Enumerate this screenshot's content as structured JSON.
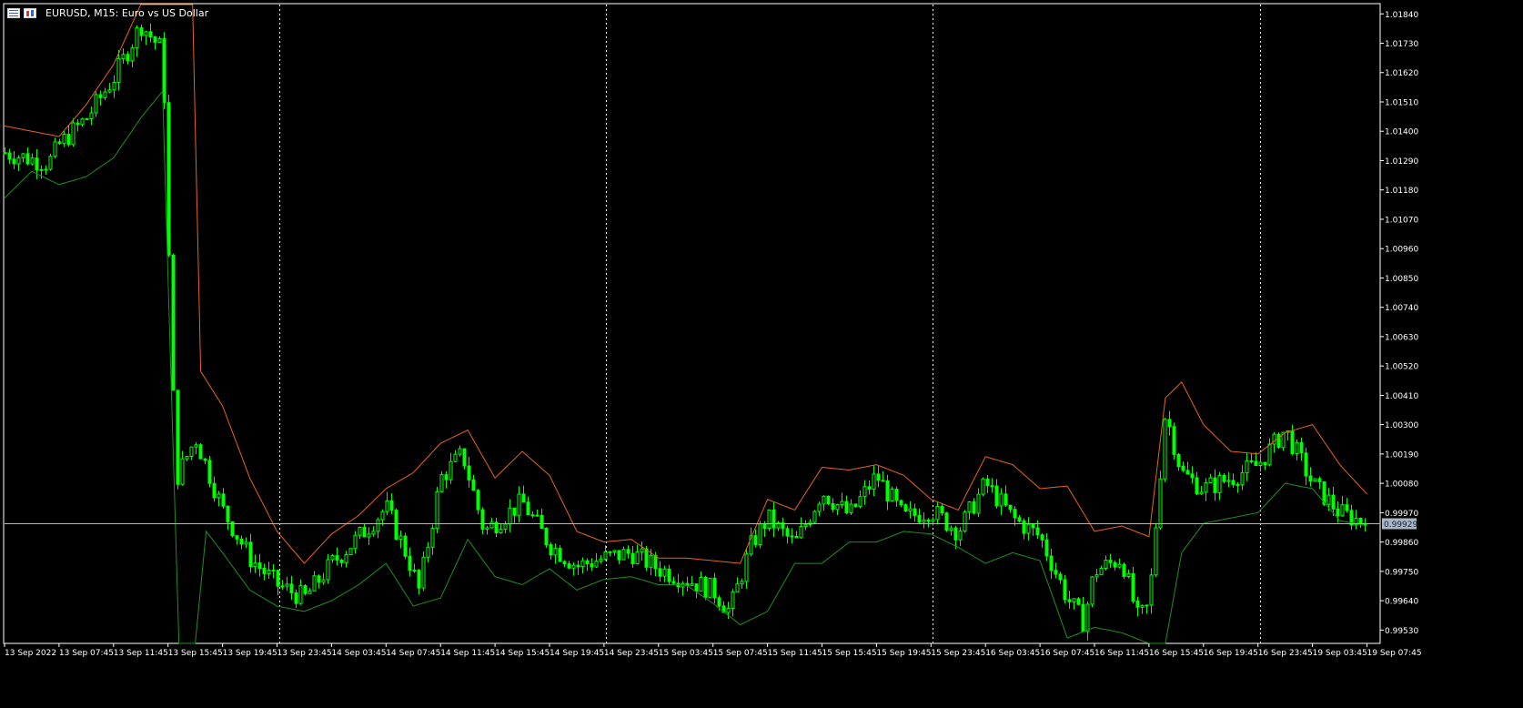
{
  "window": {
    "symbol_title": "EURUSD, M15:  Euro vs US Dollar"
  },
  "colors": {
    "background": "#000000",
    "frame": "#ffffff",
    "candles": "#00ff00",
    "upper_band": "#e8641a",
    "lower_band": "#1f8f1f",
    "bid_line": "#aab8c8",
    "price_tag_bg": "#a9b6c7",
    "price_tag_text": "#1a2330",
    "axis_text": "#ffffff",
    "period_separators": "#ffffff"
  },
  "price_axis": {
    "labels": [
      "1.01840",
      "1.01730",
      "1.01620",
      "1.01510",
      "1.01400",
      "1.01290",
      "1.01180",
      "1.01070",
      "1.00960",
      "1.00850",
      "1.00740",
      "1.00630",
      "1.00520",
      "1.00410",
      "1.00300",
      "1.00190",
      "1.00080",
      "0.99970",
      "0.99860",
      "0.99750",
      "0.99640",
      "0.99530"
    ],
    "range": [
      0.9948,
      1.01875
    ],
    "current_price": "0.99929",
    "current_price_value": 0.99929
  },
  "time_axis": {
    "labels": [
      "13 Sep 2022",
      "13 Sep 07:45",
      "13 Sep 11:45",
      "13 Sep 15:45",
      "13 Sep 19:45",
      "13 Sep 23:45",
      "14 Sep 03:45",
      "14 Sep 07:45",
      "14 Sep 11:45",
      "14 Sep 15:45",
      "14 Sep 19:45",
      "14 Sep 23:45",
      "15 Sep 03:45",
      "15 Sep 07:45",
      "15 Sep 11:45",
      "15 Sep 15:45",
      "15 Sep 19:45",
      "15 Sep 23:45",
      "16 Sep 03:45",
      "16 Sep 07:45",
      "16 Sep 11:45",
      "16 Sep 15:45",
      "16 Sep 19:45",
      "16 Sep 23:45",
      "19 Sep 03:45",
      "19 Sep 07:45"
    ]
  },
  "chart_data": {
    "type": "candlestick",
    "symbol": "EURUSD",
    "timeframe": "M15",
    "indicator": "bands",
    "x": [
      "13 Sep 2022",
      "13 Sep 07:45",
      "13 Sep 11:45",
      "13 Sep 15:45",
      "13 Sep 19:45",
      "13 Sep 23:45",
      "14 Sep 03:45",
      "14 Sep 07:45",
      "14 Sep 11:45",
      "14 Sep 15:45",
      "14 Sep 19:45",
      "14 Sep 23:45",
      "15 Sep 03:45",
      "15 Sep 07:45",
      "15 Sep 11:45",
      "15 Sep 15:45",
      "15 Sep 19:45",
      "15 Sep 23:45",
      "16 Sep 03:45",
      "16 Sep 07:45",
      "16 Sep 11:45",
      "16 Sep 15:45",
      "16 Sep 19:45",
      "16 Sep 23:45",
      "19 Sep 03:45",
      "19 Sep 07:45"
    ],
    "close_anchors": [
      {
        "x": 0,
        "close": 1.0132
      },
      {
        "x": 0.8,
        "close": 1.0128
      },
      {
        "x": 1.0,
        "close": 1.0135
      },
      {
        "x": 1.5,
        "close": 1.0145
      },
      {
        "x": 2.0,
        "close": 1.016
      },
      {
        "x": 2.5,
        "close": 1.018
      },
      {
        "x": 2.9,
        "close": 1.017
      },
      {
        "x": 3.05,
        "close": 1.006
      },
      {
        "x": 3.15,
        "close": 1.001
      },
      {
        "x": 3.5,
        "close": 1.0025
      },
      {
        "x": 4.0,
        "close": 0.9998
      },
      {
        "x": 4.5,
        "close": 0.998
      },
      {
        "x": 5.0,
        "close": 0.997
      },
      {
        "x": 5.5,
        "close": 0.9965
      },
      {
        "x": 6.0,
        "close": 0.9978
      },
      {
        "x": 6.5,
        "close": 0.9988
      },
      {
        "x": 7.0,
        "close": 0.9999
      },
      {
        "x": 7.4,
        "close": 0.998
      },
      {
        "x": 7.6,
        "close": 0.9968
      },
      {
        "x": 8.0,
        "close": 1.001
      },
      {
        "x": 8.4,
        "close": 1.0019
      },
      {
        "x": 8.8,
        "close": 0.999
      },
      {
        "x": 9.5,
        "close": 1.0001
      },
      {
        "x": 10.0,
        "close": 0.9985
      },
      {
        "x": 10.5,
        "close": 0.9977
      },
      {
        "x": 11.0,
        "close": 0.998
      },
      {
        "x": 11.5,
        "close": 0.9982
      },
      {
        "x": 12.0,
        "close": 0.9976
      },
      {
        "x": 12.5,
        "close": 0.9972
      },
      {
        "x": 13.0,
        "close": 0.9968
      },
      {
        "x": 13.3,
        "close": 0.996
      },
      {
        "x": 13.7,
        "close": 0.9985
      },
      {
        "x": 14.0,
        "close": 0.9995
      },
      {
        "x": 14.5,
        "close": 0.9985
      },
      {
        "x": 15.0,
        "close": 1.0005
      },
      {
        "x": 15.5,
        "close": 0.9996
      },
      {
        "x": 16.0,
        "close": 1.0011
      },
      {
        "x": 16.5,
        "close": 0.9995
      },
      {
        "x": 17.0,
        "close": 0.9998
      },
      {
        "x": 17.5,
        "close": 0.999
      },
      {
        "x": 18.0,
        "close": 1.0008
      },
      {
        "x": 18.5,
        "close": 0.9995
      },
      {
        "x": 19.0,
        "close": 0.9988
      },
      {
        "x": 19.5,
        "close": 0.9965
      },
      {
        "x": 19.8,
        "close": 0.9956
      },
      {
        "x": 20.0,
        "close": 0.9975
      },
      {
        "x": 20.5,
        "close": 0.998
      },
      {
        "x": 20.8,
        "close": 0.9957
      },
      {
        "x": 21.0,
        "close": 0.9962
      },
      {
        "x": 21.3,
        "close": 1.0035
      },
      {
        "x": 21.6,
        "close": 1.0012
      },
      {
        "x": 22.0,
        "close": 1.0006
      },
      {
        "x": 22.5,
        "close": 1.001
      },
      {
        "x": 23.0,
        "close": 1.0015
      },
      {
        "x": 23.5,
        "close": 1.0028
      },
      {
        "x": 24.0,
        "close": 1.0008
      },
      {
        "x": 24.5,
        "close": 0.9997
      },
      {
        "x": 25.0,
        "close": 0.99929
      }
    ],
    "upper_band_anchors": [
      {
        "x": 0,
        "value": 1.0142
      },
      {
        "x": 1.0,
        "value": 1.0138
      },
      {
        "x": 1.5,
        "value": 1.015
      },
      {
        "x": 2.0,
        "value": 1.0165
      },
      {
        "x": 2.5,
        "value": 1.01875
      },
      {
        "x": 3.45,
        "value": 1.01875
      },
      {
        "x": 3.6,
        "value": 1.005
      },
      {
        "x": 4.0,
        "value": 1.0037
      },
      {
        "x": 4.5,
        "value": 1.001
      },
      {
        "x": 5.0,
        "value": 0.999
      },
      {
        "x": 5.5,
        "value": 0.9978
      },
      {
        "x": 6.0,
        "value": 0.9989
      },
      {
        "x": 6.5,
        "value": 0.9996
      },
      {
        "x": 7.0,
        "value": 1.0006
      },
      {
        "x": 7.5,
        "value": 1.0012
      },
      {
        "x": 8.0,
        "value": 1.0023
      },
      {
        "x": 8.5,
        "value": 1.0028
      },
      {
        "x": 9.0,
        "value": 1.001
      },
      {
        "x": 9.5,
        "value": 1.002
      },
      {
        "x": 10.0,
        "value": 1.0011
      },
      {
        "x": 10.5,
        "value": 0.999
      },
      {
        "x": 11.0,
        "value": 0.9986
      },
      {
        "x": 11.5,
        "value": 0.9987
      },
      {
        "x": 12.0,
        "value": 0.998
      },
      {
        "x": 12.5,
        "value": 0.998
      },
      {
        "x": 13.0,
        "value": 0.9979
      },
      {
        "x": 13.5,
        "value": 0.9978
      },
      {
        "x": 14.0,
        "value": 1.0002
      },
      {
        "x": 14.5,
        "value": 0.9998
      },
      {
        "x": 15.0,
        "value": 1.0014
      },
      {
        "x": 15.5,
        "value": 1.0013
      },
      {
        "x": 16.0,
        "value": 1.0015
      },
      {
        "x": 16.5,
        "value": 1.0011
      },
      {
        "x": 17.0,
        "value": 1.0002
      },
      {
        "x": 17.5,
        "value": 0.9998
      },
      {
        "x": 18.0,
        "value": 1.0018
      },
      {
        "x": 18.5,
        "value": 1.0015
      },
      {
        "x": 19.0,
        "value": 1.0006
      },
      {
        "x": 19.5,
        "value": 1.0007
      },
      {
        "x": 20.0,
        "value": 0.999
      },
      {
        "x": 20.5,
        "value": 0.9992
      },
      {
        "x": 21.0,
        "value": 0.9988
      },
      {
        "x": 21.3,
        "value": 1.004
      },
      {
        "x": 21.6,
        "value": 1.0046
      },
      {
        "x": 22.0,
        "value": 1.003
      },
      {
        "x": 22.5,
        "value": 1.002
      },
      {
        "x": 23.0,
        "value": 1.0019
      },
      {
        "x": 23.5,
        "value": 1.0027
      },
      {
        "x": 24.0,
        "value": 1.003
      },
      {
        "x": 24.5,
        "value": 1.0015
      },
      {
        "x": 25.0,
        "value": 1.0004
      }
    ],
    "lower_band_anchors": [
      {
        "x": 0,
        "value": 1.0115
      },
      {
        "x": 0.5,
        "value": 1.0125
      },
      {
        "x": 1.0,
        "value": 1.012
      },
      {
        "x": 1.5,
        "value": 1.0123
      },
      {
        "x": 2.0,
        "value": 1.013
      },
      {
        "x": 2.5,
        "value": 1.0145
      },
      {
        "x": 2.9,
        "value": 1.0155
      },
      {
        "x": 3.05,
        "value": 1.005
      },
      {
        "x": 3.2,
        "value": 0.9948
      },
      {
        "x": 3.5,
        "value": 0.9948
      },
      {
        "x": 3.7,
        "value": 0.999
      },
      {
        "x": 4.0,
        "value": 0.9982
      },
      {
        "x": 4.5,
        "value": 0.9968
      },
      {
        "x": 5.0,
        "value": 0.9962
      },
      {
        "x": 5.5,
        "value": 0.996
      },
      {
        "x": 6.0,
        "value": 0.9964
      },
      {
        "x": 6.5,
        "value": 0.997
      },
      {
        "x": 7.0,
        "value": 0.9978
      },
      {
        "x": 7.5,
        "value": 0.9962
      },
      {
        "x": 8.0,
        "value": 0.9965
      },
      {
        "x": 8.5,
        "value": 0.9987
      },
      {
        "x": 9.0,
        "value": 0.9973
      },
      {
        "x": 9.5,
        "value": 0.997
      },
      {
        "x": 10.0,
        "value": 0.9976
      },
      {
        "x": 10.5,
        "value": 0.9968
      },
      {
        "x": 11.0,
        "value": 0.9972
      },
      {
        "x": 11.5,
        "value": 0.9973
      },
      {
        "x": 12.0,
        "value": 0.997
      },
      {
        "x": 12.5,
        "value": 0.997
      },
      {
        "x": 13.0,
        "value": 0.9963
      },
      {
        "x": 13.5,
        "value": 0.9955
      },
      {
        "x": 14.0,
        "value": 0.996
      },
      {
        "x": 14.5,
        "value": 0.9978
      },
      {
        "x": 15.0,
        "value": 0.9978
      },
      {
        "x": 15.5,
        "value": 0.9986
      },
      {
        "x": 16.0,
        "value": 0.9986
      },
      {
        "x": 16.5,
        "value": 0.999
      },
      {
        "x": 17.0,
        "value": 0.9989
      },
      {
        "x": 17.5,
        "value": 0.9984
      },
      {
        "x": 18.0,
        "value": 0.9978
      },
      {
        "x": 18.5,
        "value": 0.9982
      },
      {
        "x": 19.0,
        "value": 0.9979
      },
      {
        "x": 19.5,
        "value": 0.995
      },
      {
        "x": 20.0,
        "value": 0.9954
      },
      {
        "x": 20.5,
        "value": 0.9952
      },
      {
        "x": 21.0,
        "value": 0.9948
      },
      {
        "x": 21.3,
        "value": 0.9948
      },
      {
        "x": 21.6,
        "value": 0.9982
      },
      {
        "x": 22.0,
        "value": 0.9993
      },
      {
        "x": 22.5,
        "value": 0.9995
      },
      {
        "x": 23.0,
        "value": 0.9997
      },
      {
        "x": 23.5,
        "value": 1.0008
      },
      {
        "x": 24.0,
        "value": 1.0006
      },
      {
        "x": 24.5,
        "value": 0.9994
      },
      {
        "x": 25.0,
        "value": 0.9992
      }
    ],
    "period_separators": [
      "13 Sep 23:45",
      "14 Sep 23:45",
      "15 Sep 23:45",
      "16 Sep 23:45"
    ],
    "grid": false
  }
}
